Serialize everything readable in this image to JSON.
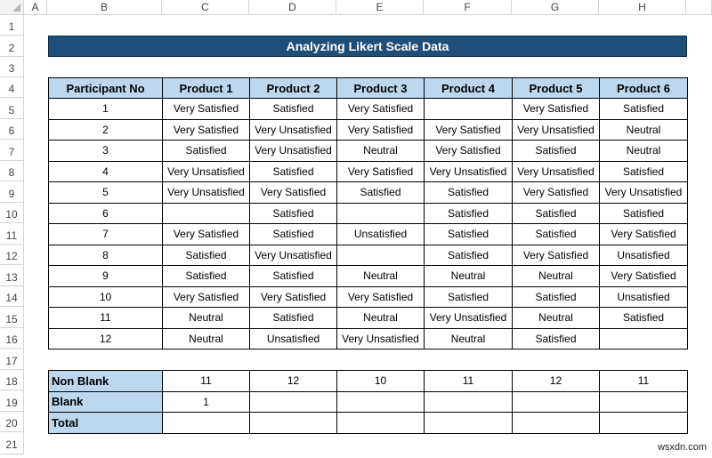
{
  "sheet": {
    "columns": [
      "A",
      "B",
      "C",
      "D",
      "E",
      "F",
      "G",
      "H"
    ],
    "rows": [
      "1",
      "2",
      "3",
      "4",
      "5",
      "6",
      "7",
      "8",
      "9",
      "10",
      "11",
      "12",
      "13",
      "14",
      "15",
      "16",
      "17",
      "18",
      "19",
      "20",
      "21"
    ]
  },
  "title": "Analyzing Likert Scale Data",
  "table": {
    "headers": [
      "Participant No",
      "Product 1",
      "Product 2",
      "Product 3",
      "Product 4",
      "Product 5",
      "Product 6"
    ],
    "rows": [
      [
        "1",
        "Very Satisfied",
        "Satisfied",
        "Very Satisfied",
        "",
        "Very Satisfied",
        "Satisfied"
      ],
      [
        "2",
        "Very Satisfied",
        "Very Unsatisfied",
        "Very Satisfied",
        "Very Satisfied",
        "Very Unsatisfied",
        "Neutral"
      ],
      [
        "3",
        "Satisfied",
        "Very Unsatisfied",
        "Neutral",
        "Very Satisfied",
        "Satisfied",
        "Neutral"
      ],
      [
        "4",
        "Very Unsatisfied",
        "Satisfied",
        "Very Satisfied",
        "Very Unsatisfied",
        "Very Unsatisfied",
        "Satisfied"
      ],
      [
        "5",
        "Very Unsatisfied",
        "Very Satisfied",
        "Satisfied",
        "Satisfied",
        "Very Satisfied",
        "Very Unsatisfied"
      ],
      [
        "6",
        "",
        "Satisfied",
        "",
        "Satisfied",
        "Satisfied",
        "Satisfied"
      ],
      [
        "7",
        "Very Satisfied",
        "Satisfied",
        "Unsatisfied",
        "Satisfied",
        "Satisfied",
        "Very Satisfied"
      ],
      [
        "8",
        "Satisfied",
        "Very Unsatisfied",
        "",
        "Satisfied",
        "Very Satisfied",
        "Unsatisfied"
      ],
      [
        "9",
        "Satisfied",
        "Satisfied",
        "Neutral",
        "Neutral",
        "Neutral",
        "Very Satisfied"
      ],
      [
        "10",
        "Very Satisfied",
        "Very Satisfied",
        "Very Satisfied",
        "Satisfied",
        "Satisfied",
        "Unsatisfied"
      ],
      [
        "11",
        "Neutral",
        "Satisfied",
        "Neutral",
        "Very Unsatisfied",
        "Neutral",
        "Satisfied"
      ],
      [
        "12",
        "Neutral",
        "Unsatisfied",
        "Very Unsatisfied",
        "Neutral",
        "Satisfied",
        ""
      ]
    ]
  },
  "summary": {
    "rows": [
      {
        "label": "Non Blank",
        "values": [
          "11",
          "12",
          "10",
          "11",
          "12",
          "11"
        ]
      },
      {
        "label": "Blank",
        "values": [
          "1",
          "",
          "",
          "",
          "",
          ""
        ]
      },
      {
        "label": "Total",
        "values": [
          "",
          "",
          "",
          "",
          "",
          ""
        ]
      }
    ]
  },
  "watermark": "wsxdn.com"
}
